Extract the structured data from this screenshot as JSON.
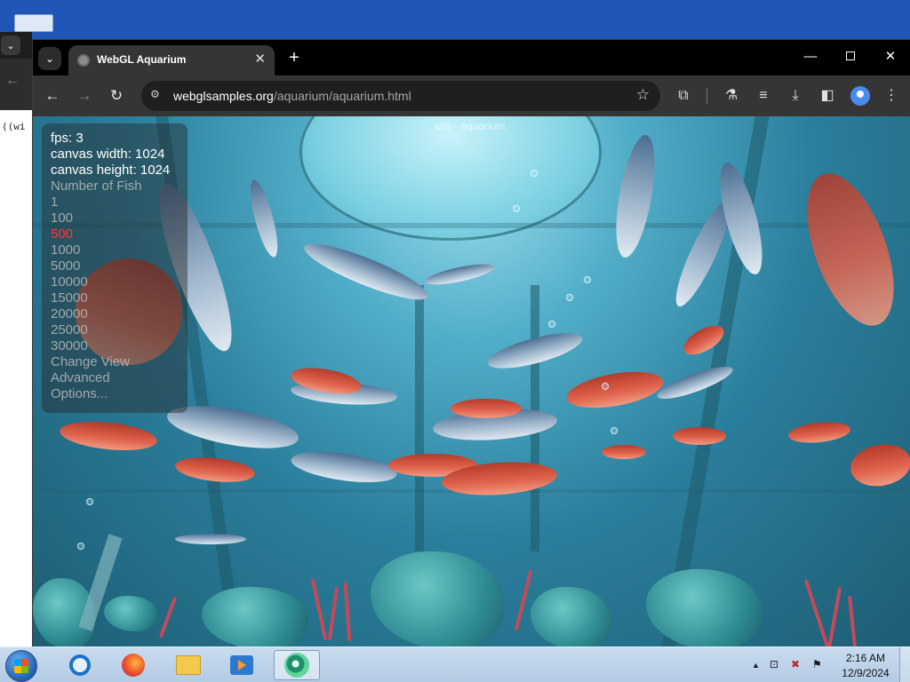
{
  "background_window": {
    "tab_button_icon": "chevron-down-icon",
    "back_icon": "arrow-left-icon",
    "code_text": "((wi"
  },
  "browser": {
    "tab": {
      "title": "WebGL Aquarium",
      "favicon": "globe-icon",
      "close_icon": "close-icon"
    },
    "new_tab_icon": "plus-icon",
    "window_controls": {
      "minimize_icon": "minimize-icon",
      "maximize_icon": "maximize-icon",
      "close_icon": "close-icon"
    },
    "toolbar": {
      "back_icon": "arrow-left-icon",
      "forward_icon": "arrow-right-icon",
      "reload_icon": "reload-icon",
      "site_info_icon": "tune-icon",
      "url_host": "webglsamples.org",
      "url_path": "/aquarium/aquarium.html",
      "bookmark_icon": "star-icon",
      "extensions_icon": "puzzle-icon",
      "labs_icon": "flask-icon",
      "media_icon": "playlist-icon",
      "download_icon": "download-icon",
      "sidepanel_icon": "side-panel-icon",
      "profile_icon": "avatar-icon",
      "menu_icon": "kebab-menu-icon"
    }
  },
  "aquarium": {
    "caption": "idle - aquarium",
    "stats": {
      "fps": "fps: 3",
      "canvas_width": "canvas width: 1024",
      "canvas_height": "canvas height: 1024"
    },
    "options_title": "Number of Fish",
    "fish_options": [
      "1",
      "100",
      "500",
      "1000",
      "5000",
      "10000",
      "15000",
      "20000",
      "25000",
      "30000"
    ],
    "selected_fish_option": "500",
    "change_view": "Change View",
    "advanced": "Advanced",
    "options": "Options..."
  },
  "taskbar": {
    "start_icon": "windows-start-icon",
    "apps": [
      {
        "name": "internet-explorer-icon"
      },
      {
        "name": "firefox-icon"
      },
      {
        "name": "folder-icon"
      },
      {
        "name": "media-player-icon"
      },
      {
        "name": "chrome-app-icon",
        "active": true
      }
    ],
    "tray": {
      "chevron": "▲",
      "network_icon": "network-icon",
      "volume_muted_icon": "volume-muted-icon",
      "flag_icon": "flag-icon"
    },
    "clock": {
      "time": "2:16 AM",
      "date": "12/9/2024"
    }
  }
}
